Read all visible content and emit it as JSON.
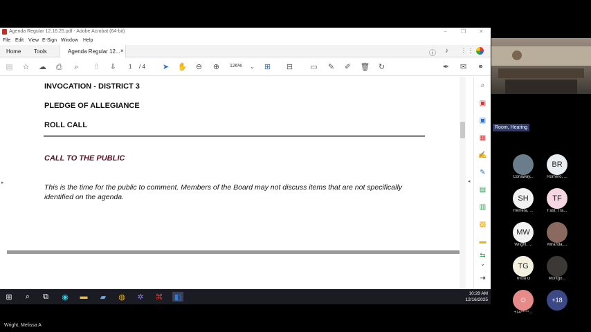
{
  "window": {
    "title": "Agenda Regular 12.16.25.pdf - Adobe Acrobat (64-bit)",
    "controls": {
      "minimize": "–",
      "restore": "❐",
      "close": "✕"
    }
  },
  "menu": [
    "File",
    "Edit",
    "View",
    "E-Sign",
    "Window",
    "Help"
  ],
  "tabs": {
    "home": "Home",
    "tools": "Tools",
    "document": "Agenda Regular 12...",
    "close": "×"
  },
  "toolbar": {
    "page_current": "1",
    "page_total": "/ 4",
    "zoom": "126%"
  },
  "document": {
    "invocation": "INVOCATION - DISTRICT 3",
    "pledge": "PLEDGE OF ALLEGIANCE",
    "roll_call": "ROLL CALL",
    "call_to_public": "CALL TO THE PUBLIC",
    "public_text": "This is the time for the public to comment. Members of the Board may not discuss items that are not specifically identified on the agenda."
  },
  "taskbar": {
    "time": "10:28 AM",
    "date": "12/16/2025"
  },
  "zoom": {
    "room_label": "Room, Hearing",
    "participants": [
      {
        "initials": "",
        "name": "Conaway...",
        "color": "#6a7d8a",
        "photo": true
      },
      {
        "initials": "BR",
        "name": "Romero, ...",
        "color": "#e9eef3",
        "photo": false
      },
      {
        "initials": "SH",
        "name": "Herrera, ...",
        "color": "#f2f2f2",
        "photo": false
      },
      {
        "initials": "TF",
        "name": "Fast, Tra...",
        "color": "#f6d6e2",
        "photo": false
      },
      {
        "initials": "MW",
        "name": "Wright, ...",
        "color": "#f2f2f2",
        "photo": false
      },
      {
        "initials": "",
        "name": "Miranda,...",
        "color": "#8a6a5e",
        "photo": true
      },
      {
        "initials": "TG",
        "name": "Tricia G",
        "color": "#f4f1e0",
        "photo": false
      },
      {
        "initials": "",
        "name": "Montgo...",
        "color": "#3c3835",
        "photo": true
      },
      {
        "initials": "",
        "name": "+14*****...",
        "color": "#e78a8a",
        "photo": false
      },
      {
        "initials": "+18",
        "name": "",
        "color": "#3b4a86",
        "photo": false
      }
    ]
  },
  "active_speaker": "Wright, Melissa A"
}
